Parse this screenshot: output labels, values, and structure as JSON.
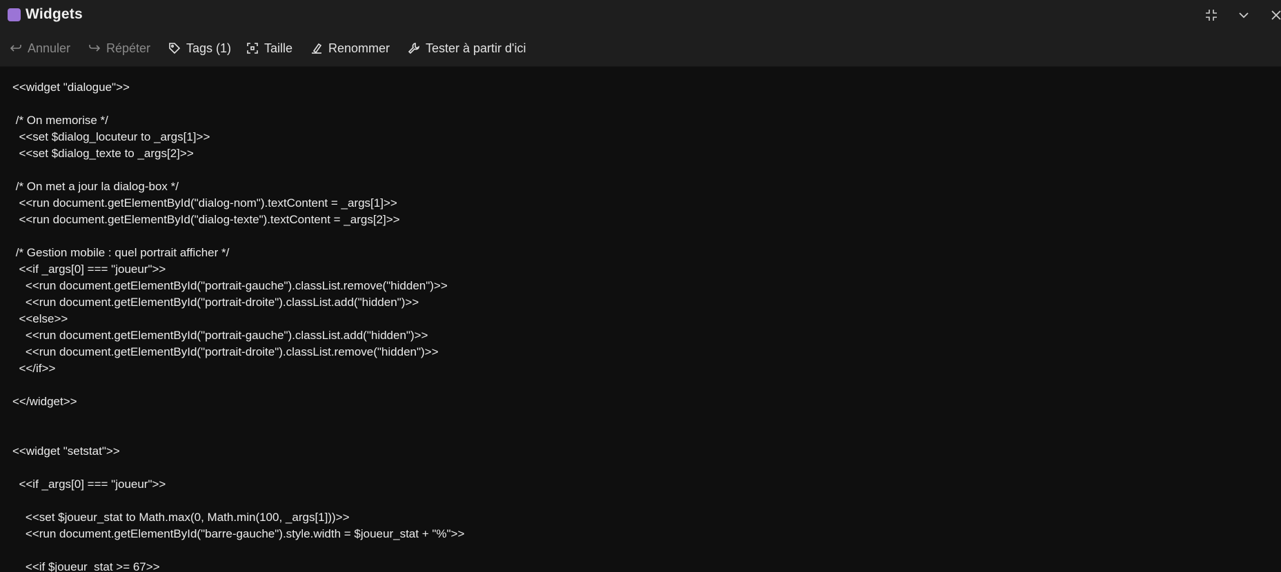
{
  "window": {
    "title": "Widgets",
    "accent_color": "#9b74d6",
    "controls": [
      "shrink-icon",
      "chevron-down-icon",
      "close-icon"
    ]
  },
  "toolbar": {
    "undo_label": "Annuler",
    "redo_label": "Répéter",
    "tags_label": "Tags (1)",
    "size_label": "Taille",
    "rename_label": "Renommer",
    "test_label": "Tester à partir d'ici"
  },
  "code": {
    "lines": [
      "<<widget \"dialogue\">>",
      "",
      " /* On memorise */",
      "  <<set $dialog_locuteur to _args[1]>>",
      "  <<set $dialog_texte to _args[2]>>",
      "",
      " /* On met a jour la dialog-box */",
      "  <<run document.getElementById(\"dialog-nom\").textContent = _args[1]>>",
      "  <<run document.getElementById(\"dialog-texte\").textContent = _args[2]>>",
      "",
      " /* Gestion mobile : quel portrait afficher */",
      "  <<if _args[0] === \"joueur\">>",
      "    <<run document.getElementById(\"portrait-gauche\").classList.remove(\"hidden\")>>",
      "    <<run document.getElementById(\"portrait-droite\").classList.add(\"hidden\")>>",
      "  <<else>>",
      "    <<run document.getElementById(\"portrait-gauche\").classList.add(\"hidden\")>>",
      "    <<run document.getElementById(\"portrait-droite\").classList.remove(\"hidden\")>>",
      "  <</if>>",
      "",
      "<</widget>>",
      "",
      "",
      "<<widget \"setstat\">>",
      "",
      "  <<if _args[0] === \"joueur\">>",
      "",
      "    <<set $joueur_stat to Math.max(0, Math.min(100, _args[1]))>>",
      "    <<run document.getElementById(\"barre-gauche\").style.width = $joueur_stat + \"%\">>",
      "",
      "    <<if $joueur_stat >= 67>>"
    ]
  }
}
